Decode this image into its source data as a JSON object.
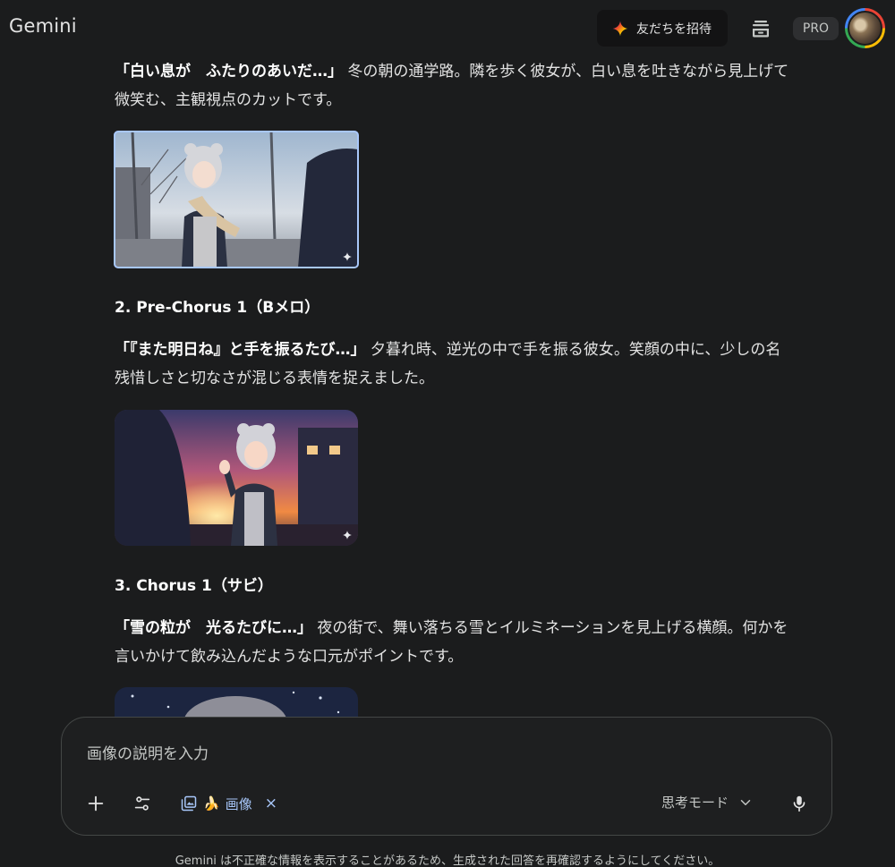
{
  "app": {
    "brand": "Gemini",
    "invite_label": "友だちを招待",
    "plan_badge": "PRO"
  },
  "sections": [
    {
      "heading": "",
      "title": "「白い息が　ふたりのあいだ…」",
      "desc_line1": "冬の朝の通学路。隣を歩く彼女が、白い息を吐きながら見上げて",
      "desc_line2": "微笑む、主観視点のカットです。"
    },
    {
      "heading": "2. Pre-Chorus 1（Bメロ）",
      "title": "「『また明日ね』と手を振るたび…」",
      "desc_line1": "夕暮れ時、逆光の中で手を振る彼女。笑顔の中に、少しの名",
      "desc_line2": "残惜しさと切なさが混じる表情を捉えました。"
    },
    {
      "heading": "3. Chorus 1（サビ）",
      "title": "「雪の粒が　光るたびに…」",
      "desc_line1": "夜の街で、舞い落ちる雪とイルミネーションを見上げる横顔。何かを",
      "desc_line2": "言いかけて飲み込んだような口元がポイントです。"
    }
  ],
  "composer": {
    "placeholder": "画像の説明を入力",
    "chip_emoji": "🍌",
    "chip_label": "画像",
    "chip_close": "×",
    "mode_label": "思考モード"
  },
  "disclaimer": "Gemini は不正確な情報を表示することがあるため、生成された回答を再確認するようにしてください。",
  "icons": {
    "invite": "sparkle-icon",
    "history": "chat-history-icon",
    "add": "plus-icon",
    "tools": "tune-icon",
    "chip": "image-gallery-icon",
    "mode_caret": "chevron-down-icon",
    "mic": "microphone-icon"
  }
}
